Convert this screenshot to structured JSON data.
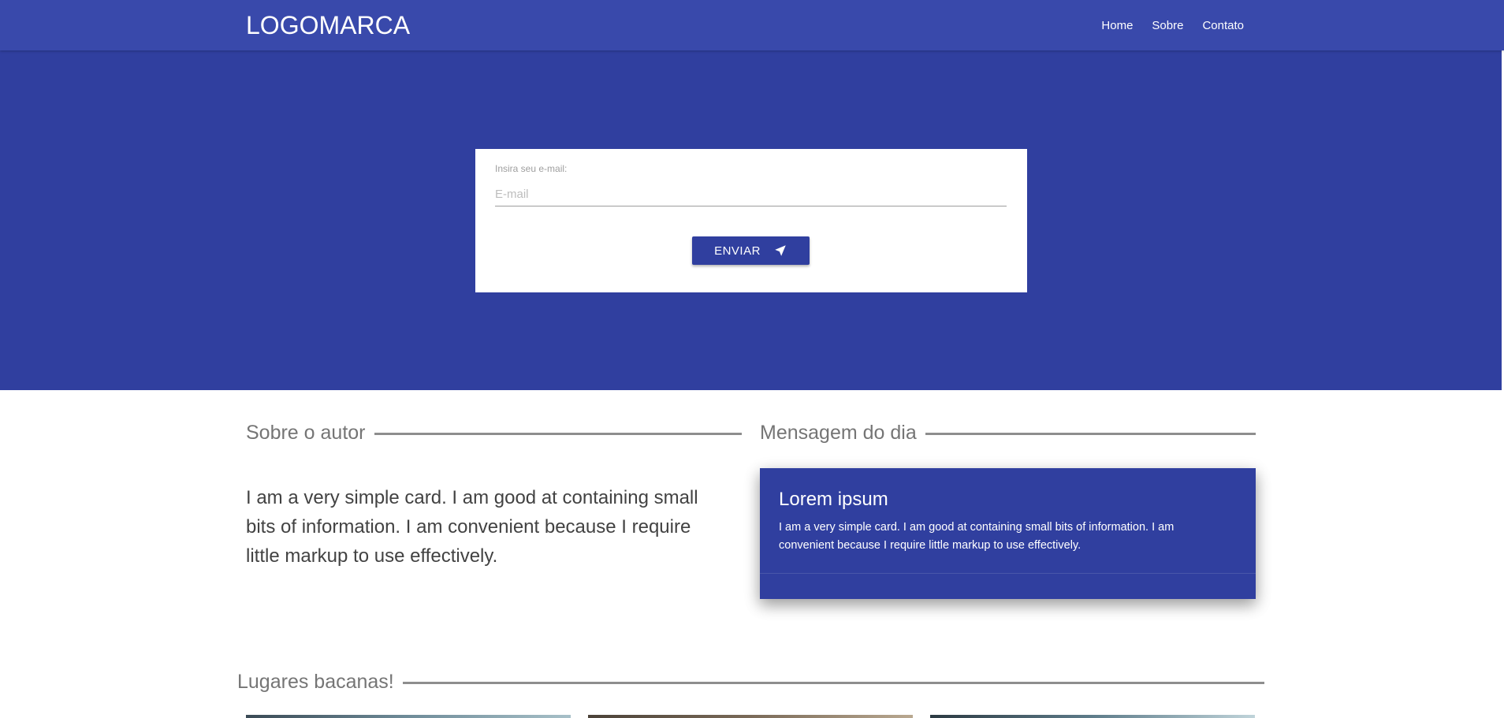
{
  "navbar": {
    "logo": "LOGOMARCA",
    "links": [
      "Home",
      "Sobre",
      "Contato"
    ]
  },
  "hero": {
    "form": {
      "label": "Insira seu e-mail:",
      "email_placeholder": "E-mail",
      "email_value": "",
      "submit_label": "ENVIAR",
      "submit_icon": "send-icon"
    }
  },
  "about": {
    "heading": "Sobre o autor",
    "text": "I am a very simple card. I am good at containing small bits of information. I am convenient because I require little markup to use effectively."
  },
  "message": {
    "heading": "Mensagem do dia",
    "card_title": "Lorem ipsum",
    "card_text": "I am a very simple card. I am good at containing small bits of information. I am convenient because I require little markup to use effectively."
  },
  "places": {
    "heading": "Lugares bacanas!"
  },
  "colors": {
    "navbar": "#3949ab",
    "hero": "#303f9f",
    "accent": "#303f9f",
    "heading_text": "#757575"
  }
}
